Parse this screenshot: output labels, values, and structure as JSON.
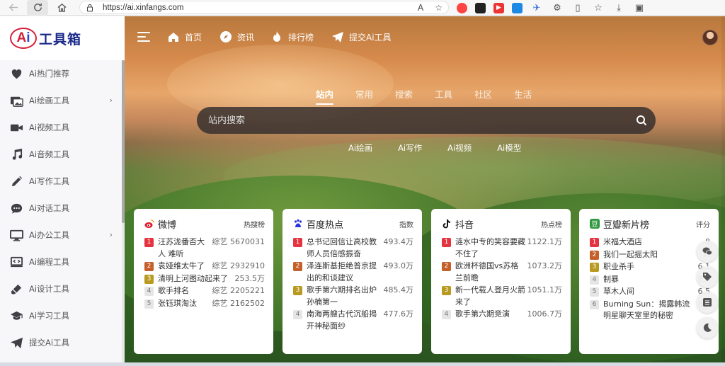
{
  "browser": {
    "url": "https://ai.xinfangs.com",
    "read_aloud": "A",
    "ext_letters": [
      "Y",
      "W",
      "E"
    ]
  },
  "sidebar": {
    "logo_badge": "Ai",
    "logo_text": "工具箱",
    "items": [
      {
        "label": "Ai热门推荐",
        "icon": "heart-icon",
        "has_arrow": false
      },
      {
        "label": "Ai绘画工具",
        "icon": "image-icon",
        "has_arrow": true
      },
      {
        "label": "Ai视频工具",
        "icon": "video-icon",
        "has_arrow": false
      },
      {
        "label": "Ai音频工具",
        "icon": "music-icon",
        "has_arrow": false
      },
      {
        "label": "Ai写作工具",
        "icon": "pencil-icon",
        "has_arrow": false
      },
      {
        "label": "Ai对话工具",
        "icon": "chat-icon",
        "has_arrow": false
      },
      {
        "label": "Ai办公工具",
        "icon": "monitor-icon",
        "has_arrow": true
      },
      {
        "label": "Ai编程工具",
        "icon": "code-icon",
        "has_arrow": false
      },
      {
        "label": "Ai设计工具",
        "icon": "brush-icon",
        "has_arrow": false
      },
      {
        "label": "Ai学习工具",
        "icon": "graduation-icon",
        "has_arrow": false
      },
      {
        "label": "提交Ai工具",
        "icon": "send-icon",
        "has_arrow": false
      }
    ],
    "arrow": "›"
  },
  "topnav": {
    "home": "首页",
    "news": "资讯",
    "ranking": "排行榜",
    "submit": "提交Ai工具"
  },
  "search": {
    "tabs": [
      "站内",
      "常用",
      "搜索",
      "工具",
      "社区",
      "生活"
    ],
    "active_tab": 0,
    "placeholder": "站内搜索",
    "quick_links": [
      "Ai绘画",
      "Ai写作",
      "Ai视频",
      "Ai模型"
    ]
  },
  "cards": [
    {
      "title": "微博",
      "tag": "热搜榜",
      "icon": "weibo-icon",
      "rows": [
        {
          "rank": "1",
          "title": "汪苏泷番否大人 难听",
          "value": "综艺 5670031"
        },
        {
          "rank": "2",
          "title": "袁娅维太牛了",
          "value": "综艺 2932910"
        },
        {
          "rank": "3",
          "title": "清明上河图动起来了",
          "value": "253.5万"
        },
        {
          "rank": "4",
          "title": "歌手排名",
          "value": "综艺 2205221"
        },
        {
          "rank": "5",
          "title": "张钰琪淘汰",
          "value": "综艺 2162502"
        }
      ]
    },
    {
      "title": "百度热点",
      "tag": "指数",
      "icon": "baidu-icon",
      "rows": [
        {
          "rank": "1",
          "title": "总书记回信让高校教师人员倍感振奋",
          "value": "493.4万"
        },
        {
          "rank": "2",
          "title": "泽连斯基拒绝普京提出的和谈建议",
          "value": "493.0万"
        },
        {
          "rank": "3",
          "title": "歌手第六期排名出炉 孙楠第一",
          "value": "485.4万"
        },
        {
          "rank": "4",
          "title": "南海两艘古代沉船揭开神秘面纱",
          "value": "477.6万"
        }
      ]
    },
    {
      "title": "抖音",
      "tag": "热点榜",
      "icon": "douyin-icon",
      "rows": [
        {
          "rank": "1",
          "title": "涟水中专的笑容要藏不住了",
          "value": "1122.1万"
        },
        {
          "rank": "2",
          "title": "欧洲杯德国vs苏格兰前瞻",
          "value": "1073.2万"
        },
        {
          "rank": "3",
          "title": "新一代载人登月火箭来了",
          "value": "1051.1万"
        },
        {
          "rank": "4",
          "title": "歌手第六期竞演",
          "value": "1006.7万"
        }
      ]
    },
    {
      "title": "豆瓣新片榜",
      "tag": "评分",
      "icon": "douban-icon",
      "rows": [
        {
          "rank": "1",
          "title": "米福大酒店",
          "value": "8"
        },
        {
          "rank": "2",
          "title": "我们一起摇太阳",
          "value": "7."
        },
        {
          "rank": "3",
          "title": "职业杀手",
          "value": "6.1"
        },
        {
          "rank": "4",
          "title": "制暴",
          "value": "8.7"
        },
        {
          "rank": "5",
          "title": "草木人间",
          "value": "6.5"
        },
        {
          "rank": "6",
          "title": "Burning Sun：揭露韩流明星聊天室里的秘密",
          "value": "8.6"
        }
      ]
    }
  ],
  "float_tools": [
    "wechat-icon",
    "tag-icon",
    "list-icon",
    "moon-icon"
  ],
  "colors": {
    "rank1": "#e5343f",
    "rank2": "#c5602a",
    "rank3": "#b99a20",
    "logo_red": "#d4213b",
    "logo_blue": "#2a46d8"
  }
}
